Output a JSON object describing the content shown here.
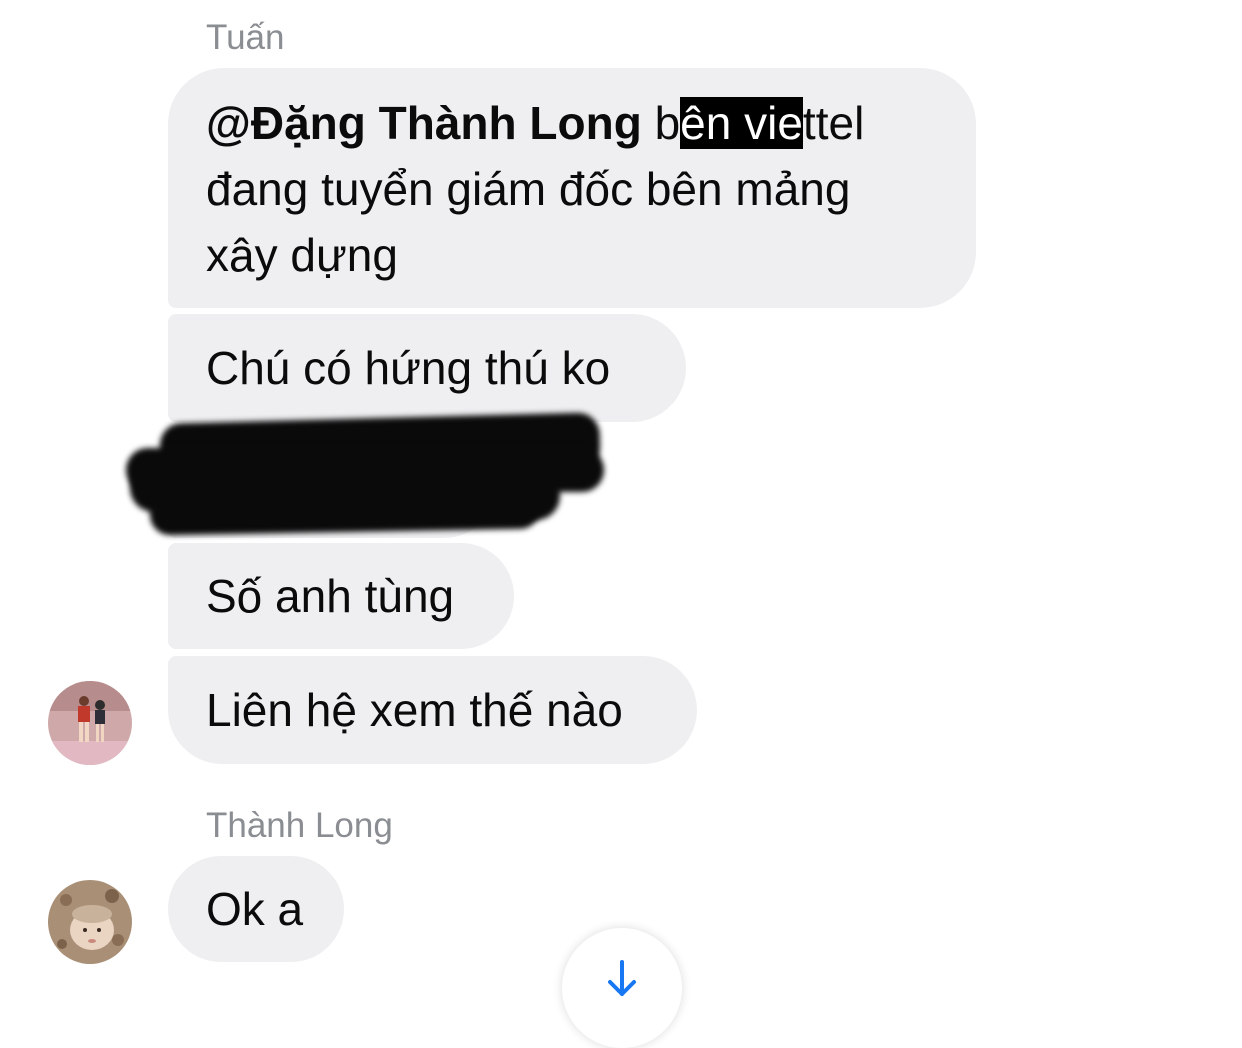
{
  "thread": {
    "group_1": {
      "sender_name": "Tuấn",
      "messages": [
        {
          "mention": "@Đặng Thành Long",
          "line1_plain": " b",
          "line1_highlight": "ên vie",
          "line1_tail": "ttel",
          "line2": "đang tuyển giám đốc bên mảng",
          "line3": "xây dựng"
        },
        {
          "text": "Chú có hứng thú ko"
        },
        {
          "text": ""
        },
        {
          "text": "Số anh tùng"
        },
        {
          "text": "Liên hệ xem thế nào"
        }
      ]
    },
    "group_2": {
      "sender_name": "Thành Long",
      "messages": [
        {
          "text": "Ok a"
        }
      ]
    }
  },
  "colors": {
    "bubble_background": "#efeff1",
    "sender_name": "#8a8d91",
    "scroll_arrow": "#1877f2",
    "redaction": "#0a0a0a"
  },
  "icons": {
    "scroll_down": "arrow-down-icon",
    "avatar_tuan": "avatar-photo",
    "avatar_thanh_long": "avatar-photo"
  }
}
